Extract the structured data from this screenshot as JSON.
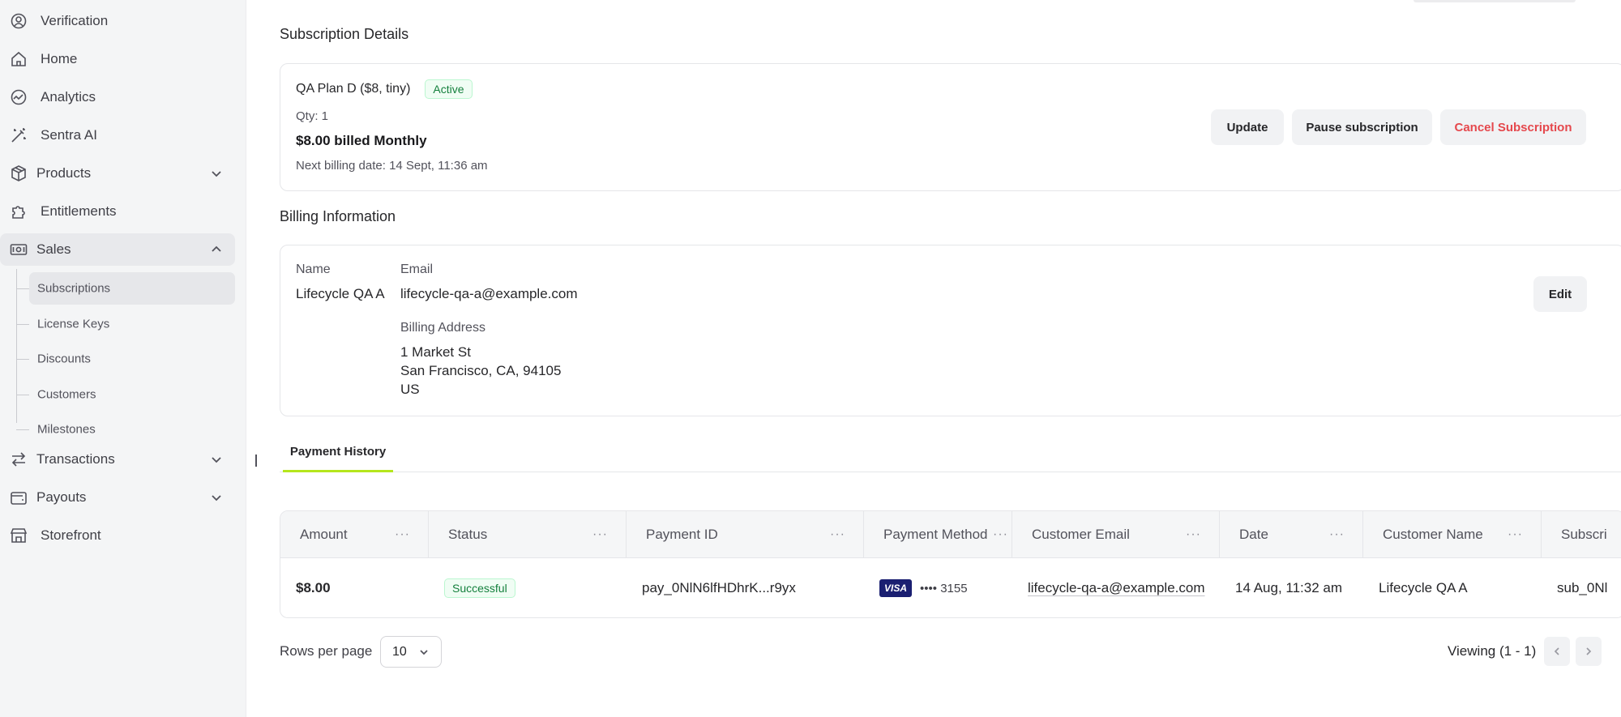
{
  "sidebar": {
    "items": [
      {
        "label": "Verification",
        "icon": "verification-icon"
      },
      {
        "label": "Home",
        "icon": "home-icon"
      },
      {
        "label": "Analytics",
        "icon": "analytics-icon"
      },
      {
        "label": "Sentra AI",
        "icon": "magic-wand-icon"
      },
      {
        "label": "Products",
        "icon": "box-icon"
      },
      {
        "label": "Entitlements",
        "icon": "puzzle-icon"
      },
      {
        "label": "Sales",
        "icon": "money-icon"
      },
      {
        "label": "Transactions",
        "icon": "arrows-icon"
      },
      {
        "label": "Payouts",
        "icon": "wallet-icon"
      },
      {
        "label": "Storefront",
        "icon": "store-icon"
      }
    ],
    "sales_subitems": [
      "Subscriptions",
      "License Keys",
      "Discounts",
      "Customers",
      "Milestones"
    ]
  },
  "subscription": {
    "section_title": "Subscription Details",
    "plan": "QA Plan D ($8, tiny)",
    "status": "Active",
    "qty": "Qty: 1",
    "price": "$8.00 billed Monthly",
    "next_billing": "Next billing date: 14 Sept, 11:36 am",
    "update_label": "Update",
    "pause_label": "Pause subscription",
    "cancel_label": "Cancel Subscription"
  },
  "billing": {
    "section_title": "Billing Information",
    "name_label": "Name",
    "name_value": "Lifecycle QA A",
    "email_label": "Email",
    "email_value": "lifecycle-qa-a@example.com",
    "address_label": "Billing Address",
    "address_line1": "1 Market St",
    "address_line2": "San Francisco, CA, 94105",
    "address_line3": "US",
    "edit_label": "Edit"
  },
  "tabs": {
    "payment_history": "Payment History"
  },
  "table": {
    "headers": [
      "Amount",
      "Status",
      "Payment ID",
      "Payment Method",
      "Customer Email",
      "Date",
      "Customer Name",
      "Subscri"
    ],
    "row": {
      "amount": "$8.00",
      "status": "Successful",
      "payment_id": "pay_0NlN6lfHDhrK...r9yx",
      "card_brand": "VISA",
      "card_masked": "•••• 3155",
      "email": "lifecycle-qa-a@example.com",
      "date": "14 Aug, 11:32 am",
      "customer_name": "Lifecycle QA A",
      "subscription": "sub_0Nl"
    }
  },
  "pagination": {
    "rows_per_page_label": "Rows per page",
    "rows_per_page_value": "10",
    "viewing": "Viewing (1 - 1)"
  },
  "colors": {
    "accent": "#b5e61d",
    "danger": "#e5484d",
    "success": "#15803d",
    "visa": "#1a1f71"
  }
}
